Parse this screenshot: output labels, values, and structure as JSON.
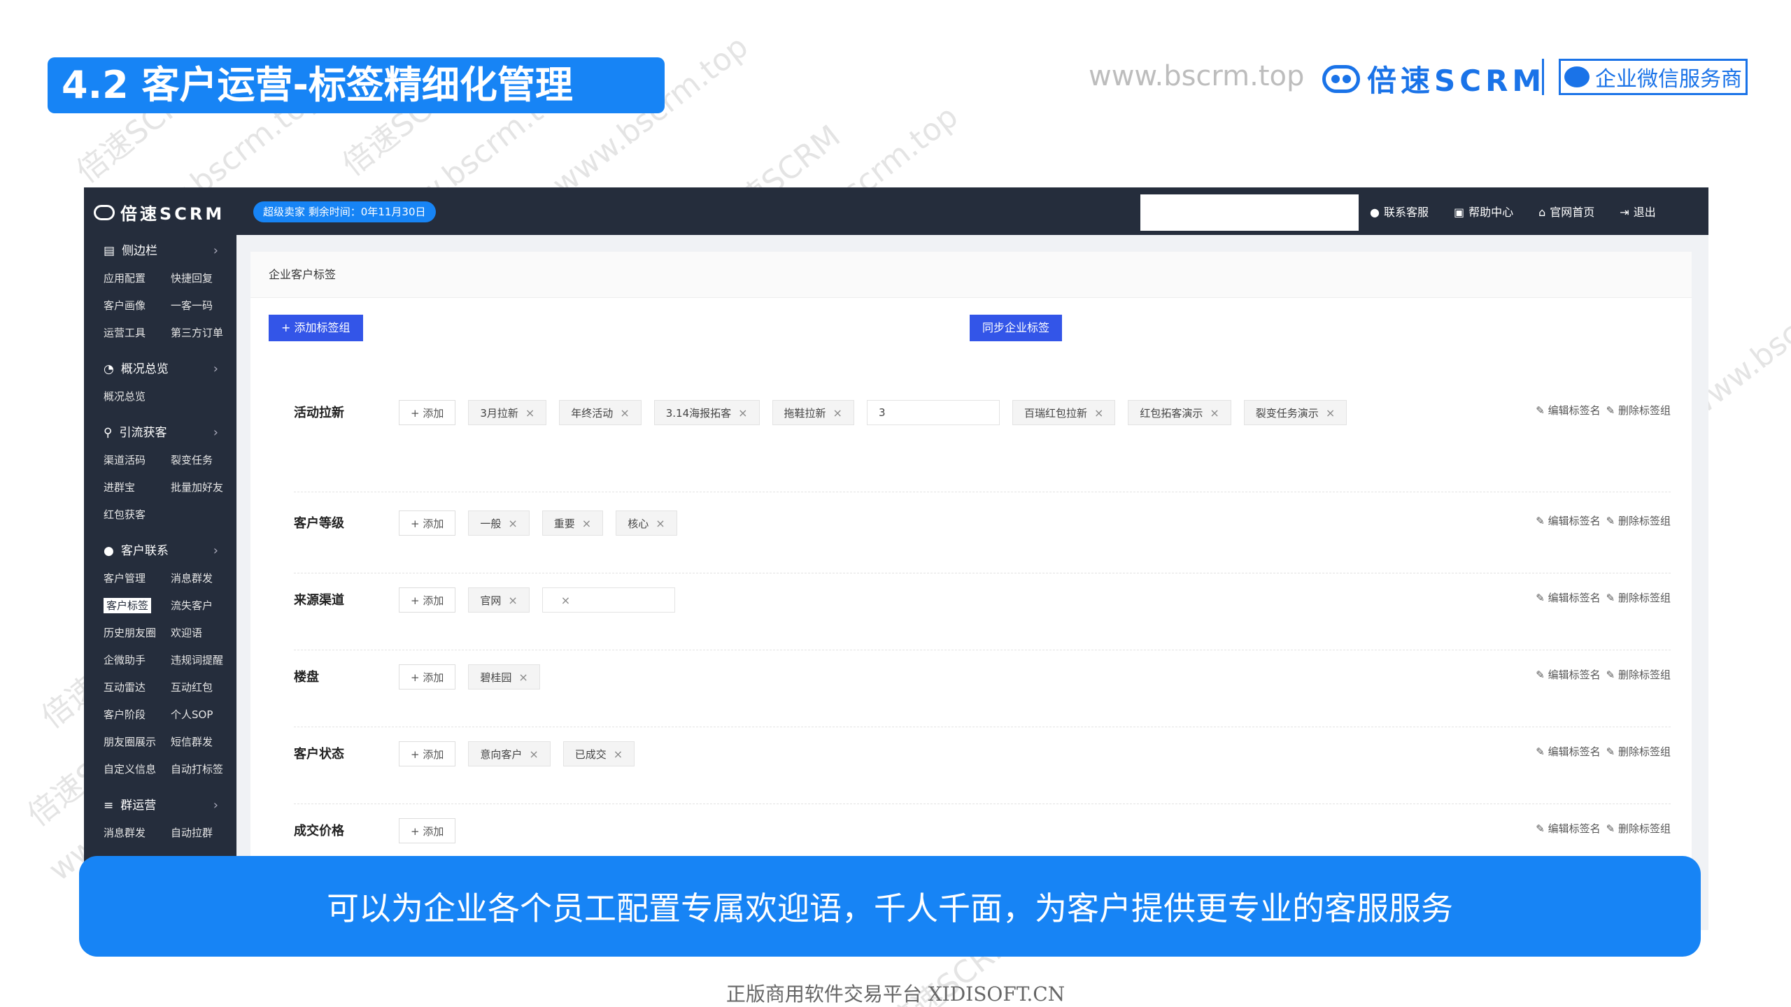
{
  "slide": {
    "title": "4.2 客户运营-标签精细化管理",
    "brand_url": "www.bscrm.top",
    "brand_name": "倍速SCRM",
    "brand_badge": "企业微信服务商",
    "caption": "可以为企业各个员工配置专属欢迎语，千人千面，为客户提供更专业的客服服务",
    "footer": "正版商用软件交易平台 XIDISOFT.CN",
    "watermark_1": "倍速SCRM",
    "watermark_2": "www.bscrm.top",
    "colors": {
      "accent": "#1784f5",
      "navy": "#252d3c",
      "button": "#3355e8"
    }
  },
  "app": {
    "logo": "倍速SCRM",
    "trial_badge": "超级卖家 剩余时间：0年11月30日",
    "top_links": [
      {
        "icon": "wechat-icon",
        "label": "联系客服"
      },
      {
        "icon": "book-icon",
        "label": "帮助中心"
      },
      {
        "icon": "home-icon",
        "label": "官网首页"
      },
      {
        "icon": "logout-icon",
        "label": "退出"
      }
    ],
    "sidebar": [
      {
        "title": "侧边栏",
        "icon": "sidebar-icon",
        "items": [
          "应用配置",
          "快捷回复",
          "客户画像",
          "一客一码",
          "运营工具",
          "第三方订单"
        ]
      },
      {
        "title": "概况总览",
        "icon": "chart-icon",
        "items": [
          "概况总览"
        ]
      },
      {
        "title": "引流获客",
        "icon": "funnel-icon",
        "items": [
          "渠道活码",
          "裂变任务",
          "进群宝",
          "批量加好友",
          "红包获客"
        ]
      },
      {
        "title": "客户联系",
        "icon": "user-icon",
        "items": [
          "客户管理",
          "消息群发",
          "客户标签",
          "流失客户",
          "历史朋友圈",
          "欢迎语",
          "企微助手",
          "违规词提醒",
          "互动雷达",
          "互动红包",
          "客户阶段",
          "个人SOP",
          "朋友圈展示",
          "短信群发",
          "自定义信息",
          "自动打标签"
        ]
      },
      {
        "title": "群运营",
        "icon": "menu-icon",
        "items": [
          "消息群发",
          "自动拉群"
        ]
      }
    ],
    "active_item": "客户标签",
    "page_title": "企业客户标签",
    "add_group_button": "+ 添加标签组",
    "sync_button": "同步企业标签",
    "add_tag_label": "+ 添加",
    "edit_label": "编辑标签名",
    "delete_label": "删除标签组",
    "groups": [
      {
        "name": "活动拉新",
        "tags": [
          "3月拉新",
          "年终活动",
          "3.14海报拓客",
          "拖鞋拉新",
          "3",
          "百瑞红包拉新",
          "红包拓客演示",
          "裂变任务演示"
        ]
      },
      {
        "name": "客户等级",
        "tags": [
          "一般",
          "重要",
          "核心"
        ]
      },
      {
        "name": "来源渠道",
        "tags": [
          "官网",
          ""
        ]
      },
      {
        "name": "楼盘",
        "tags": [
          "碧桂园"
        ]
      },
      {
        "name": "客户状态",
        "tags": [
          "意向客户",
          "已成交"
        ]
      },
      {
        "name": "成交价格",
        "tags": []
      }
    ]
  }
}
